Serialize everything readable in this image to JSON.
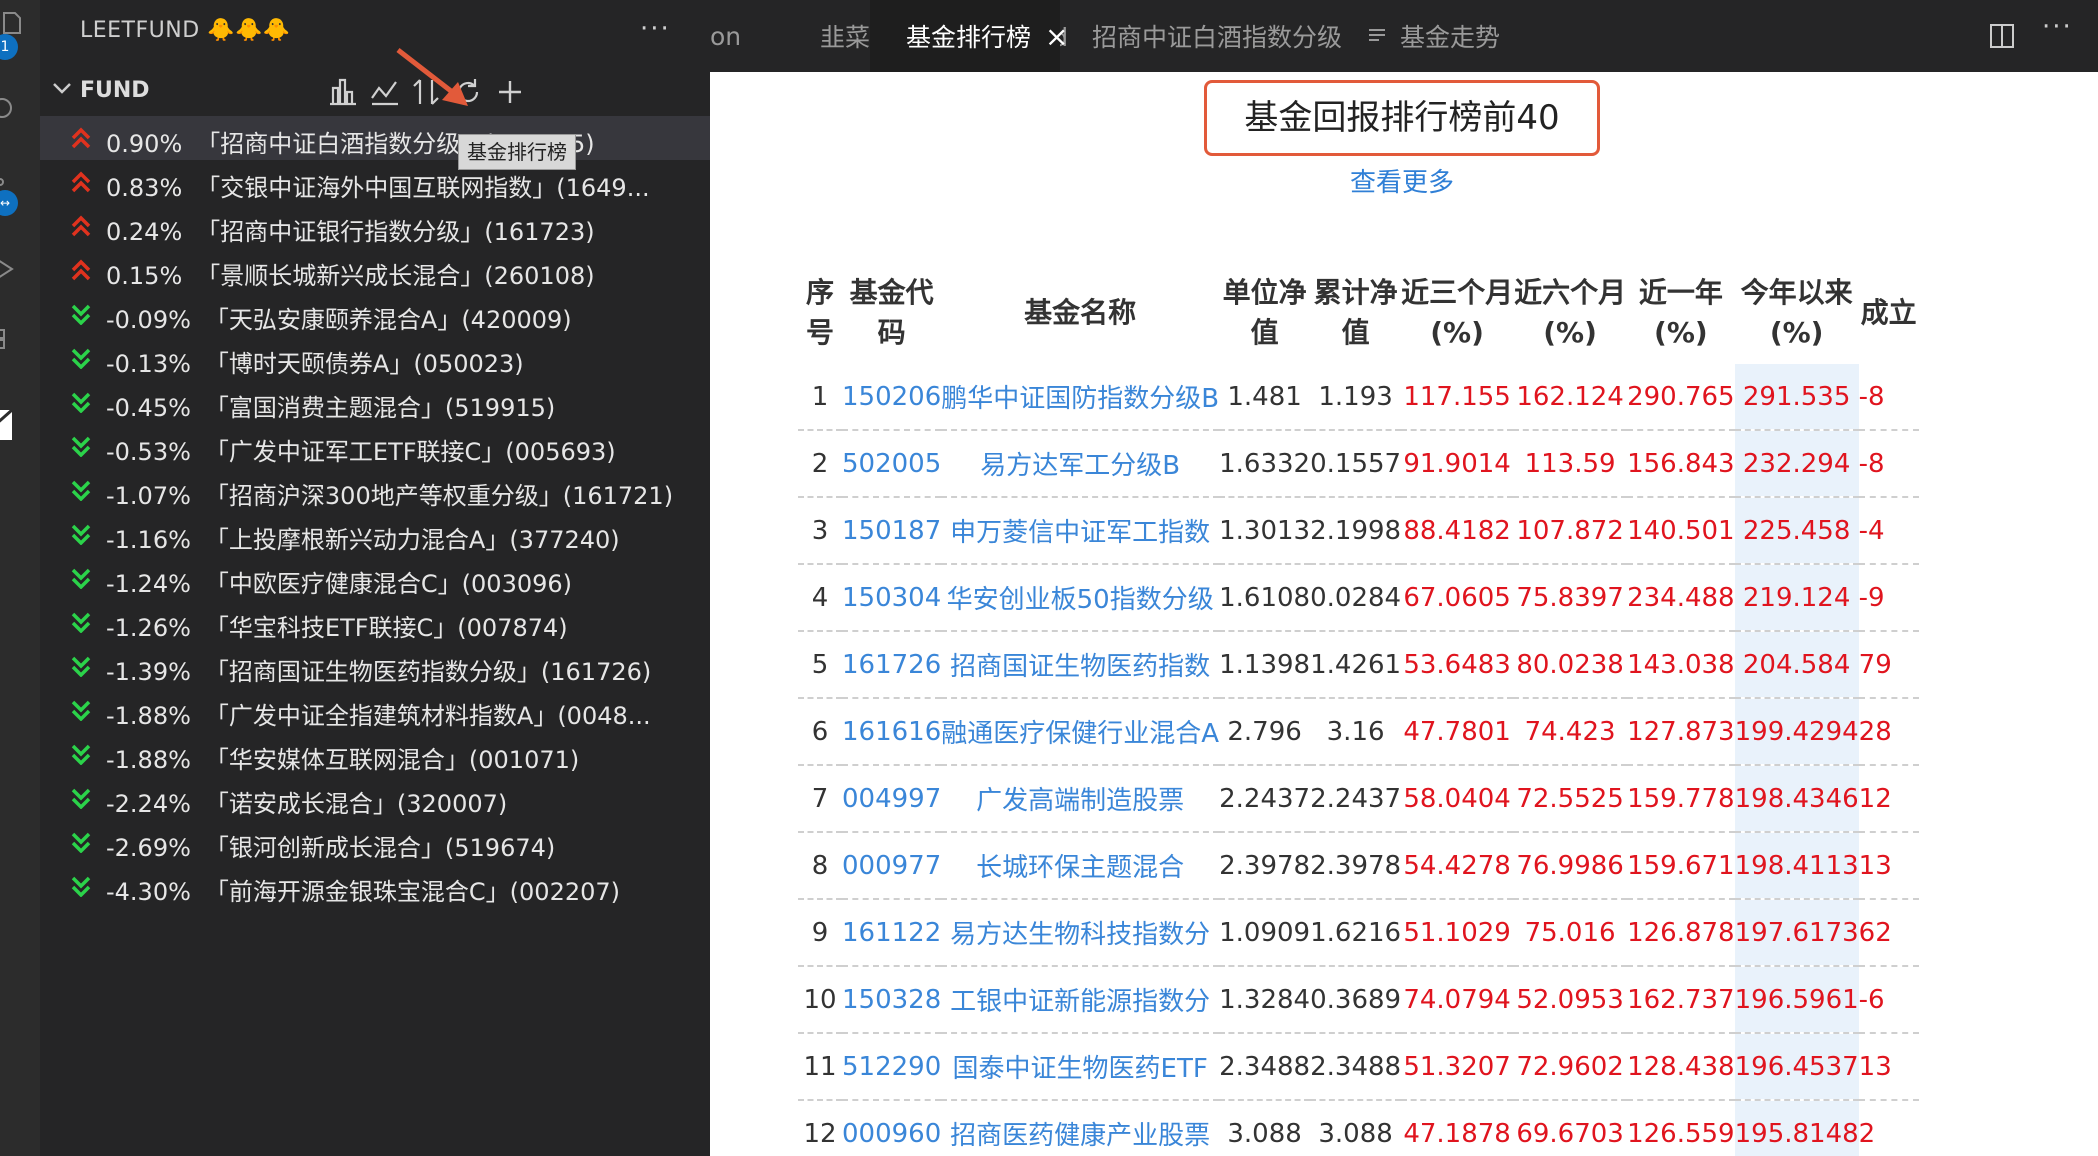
{
  "sidebar": {
    "title": "LEETFUND 🐥🐥🐥",
    "more": "···",
    "section_title": "FUND",
    "tooltip": "基金排行榜",
    "funds": [
      {
        "change": "0.90%",
        "name": "「招商中证白酒指数分级」(161725)",
        "trend": "up",
        "selected": true
      },
      {
        "change": "0.83%",
        "name": "「交银中证海外中国互联网指数」(1649...",
        "trend": "up"
      },
      {
        "change": "0.24%",
        "name": "「招商中证银行指数分级」(161723)",
        "trend": "up"
      },
      {
        "change": "0.15%",
        "name": "「景顺长城新兴成长混合」(260108)",
        "trend": "up"
      },
      {
        "change": "-0.09%",
        "name": "「天弘安康颐养混合A」(420009)",
        "trend": "down"
      },
      {
        "change": "-0.13%",
        "name": "「博时天颐债券A」(050023)",
        "trend": "down"
      },
      {
        "change": "-0.45%",
        "name": "「富国消费主题混合」(519915)",
        "trend": "down"
      },
      {
        "change": "-0.53%",
        "name": "「广发中证军工ETF联接C」(005693)",
        "trend": "down"
      },
      {
        "change": "-1.07%",
        "name": "「招商沪深300地产等权重分级」(161721)",
        "trend": "down"
      },
      {
        "change": "-1.16%",
        "name": "「上投摩根新兴动力混合A」(377240)",
        "trend": "down"
      },
      {
        "change": "-1.24%",
        "name": "「中欧医疗健康混合C」(003096)",
        "trend": "down"
      },
      {
        "change": "-1.26%",
        "name": "「华宝科技ETF联接C」(007874)",
        "trend": "down"
      },
      {
        "change": "-1.39%",
        "name": "「招商国证生物医药指数分级」(161726)",
        "trend": "down"
      },
      {
        "change": "-1.88%",
        "name": "「广发中证全指建筑材料指数A」(0048...",
        "trend": "down"
      },
      {
        "change": "-1.88%",
        "name": "「华安媒体互联网混合」(001071)",
        "trend": "down"
      },
      {
        "change": "-2.24%",
        "name": "「诺安成长混合」(320007)",
        "trend": "down"
      },
      {
        "change": "-2.69%",
        "name": "「银河创新成长混合」(519674)",
        "trend": "down"
      },
      {
        "change": "-4.30%",
        "name": "「前海开源金银珠宝混合C」(002207)",
        "trend": "down"
      }
    ]
  },
  "activity": {
    "badge1": "1"
  },
  "tabs": {
    "partial": "on",
    "guide": "韭菜基金使用指南.md",
    "ranking": "基金排行榜",
    "baijiu": "招商中证白酒指数分级",
    "trend": "基金走势",
    "more": "···"
  },
  "content": {
    "heading": "基金回报排行榜前40",
    "more_link": "查看更多",
    "columns": [
      {
        "line1": "序",
        "line2": "号"
      },
      {
        "line1": "基金代",
        "line2": "码"
      },
      {
        "line1": "基金名称",
        "line2": ""
      },
      {
        "line1": "单位净",
        "line2": "值"
      },
      {
        "line1": "累计净",
        "line2": "值"
      },
      {
        "line1": "近三个月",
        "line2": "(%)"
      },
      {
        "line1": "近六个月",
        "line2": "(%)"
      },
      {
        "line1": "近一年",
        "line2": "(%)"
      },
      {
        "line1": "今年以来",
        "line2": "(%)"
      },
      {
        "line1": "成立",
        "line2": ""
      }
    ],
    "rows": [
      {
        "idx": "1",
        "code": "150206",
        "name": "鹏华中证国防指数分级B",
        "nav": "1.481",
        "acc": "1.193",
        "m3": "117.155",
        "m6": "162.124",
        "y1": "290.765",
        "ytd": "291.535",
        "since": "-8"
      },
      {
        "idx": "2",
        "code": "502005",
        "name": "易方达军工分级B",
        "nav": "1.6332",
        "acc": "0.1557",
        "m3": "91.9014",
        "m6": "113.59",
        "y1": "156.843",
        "ytd": "232.294",
        "since": "-8"
      },
      {
        "idx": "3",
        "code": "150187",
        "name": "申万菱信中证军工指数",
        "nav": "1.3013",
        "acc": "2.1998",
        "m3": "88.4182",
        "m6": "107.872",
        "y1": "140.501",
        "ytd": "225.458",
        "since": "-4"
      },
      {
        "idx": "4",
        "code": "150304",
        "name": "华安创业板50指数分级",
        "nav": "1.6108",
        "acc": "0.0284",
        "m3": "67.0605",
        "m6": "75.8397",
        "y1": "234.488",
        "ytd": "219.124",
        "since": "-9"
      },
      {
        "idx": "5",
        "code": "161726",
        "name": "招商国证生物医药指数",
        "nav": "1.1398",
        "acc": "1.4261",
        "m3": "53.6483",
        "m6": "80.0238",
        "y1": "143.038",
        "ytd": "204.584",
        "since": "79"
      },
      {
        "idx": "6",
        "code": "161616",
        "name": "融通医疗保健行业混合A",
        "nav": "2.796",
        "acc": "3.16",
        "m3": "47.7801",
        "m6": "74.423",
        "y1": "127.873",
        "ytd": "199.4294",
        "since": "28"
      },
      {
        "idx": "7",
        "code": "004997",
        "name": "广发高端制造股票",
        "nav": "2.2437",
        "acc": "2.2437",
        "m3": "58.0404",
        "m6": "72.5525",
        "y1": "159.778",
        "ytd": "198.4346",
        "since": "12"
      },
      {
        "idx": "8",
        "code": "000977",
        "name": "长城环保主题混合",
        "nav": "2.3978",
        "acc": "2.3978",
        "m3": "54.4278",
        "m6": "76.9986",
        "y1": "159.671",
        "ytd": "198.4113",
        "since": "13"
      },
      {
        "idx": "9",
        "code": "161122",
        "name": "易方达生物科技指数分",
        "nav": "1.0909",
        "acc": "1.6216",
        "m3": "51.1029",
        "m6": "75.016",
        "y1": "126.878",
        "ytd": "197.6173",
        "since": "62"
      },
      {
        "idx": "10",
        "code": "150328",
        "name": "工银中证新能源指数分",
        "nav": "1.3284",
        "acc": "0.3689",
        "m3": "74.0794",
        "m6": "52.0953",
        "y1": "162.737",
        "ytd": "196.5961",
        "since": "-6"
      },
      {
        "idx": "11",
        "code": "512290",
        "name": "国泰中证生物医药ETF",
        "nav": "2.3488",
        "acc": "2.3488",
        "m3": "51.3207",
        "m6": "72.9602",
        "y1": "128.438",
        "ytd": "196.4537",
        "since": "13"
      },
      {
        "idx": "12",
        "code": "000960",
        "name": "招商医药健康产业股票",
        "nav": "3.088",
        "acc": "3.088",
        "m3": "47.1878",
        "m6": "69.6703",
        "y1": "126.559",
        "ytd": "195.8148",
        "since": "2"
      }
    ]
  },
  "colors": {
    "up": "#e0321e",
    "down": "#2bd34a",
    "link": "#3a86d8",
    "value_red": "#e0141e",
    "highlight": "#e9f2fb",
    "annotation": "#e25a3a"
  }
}
